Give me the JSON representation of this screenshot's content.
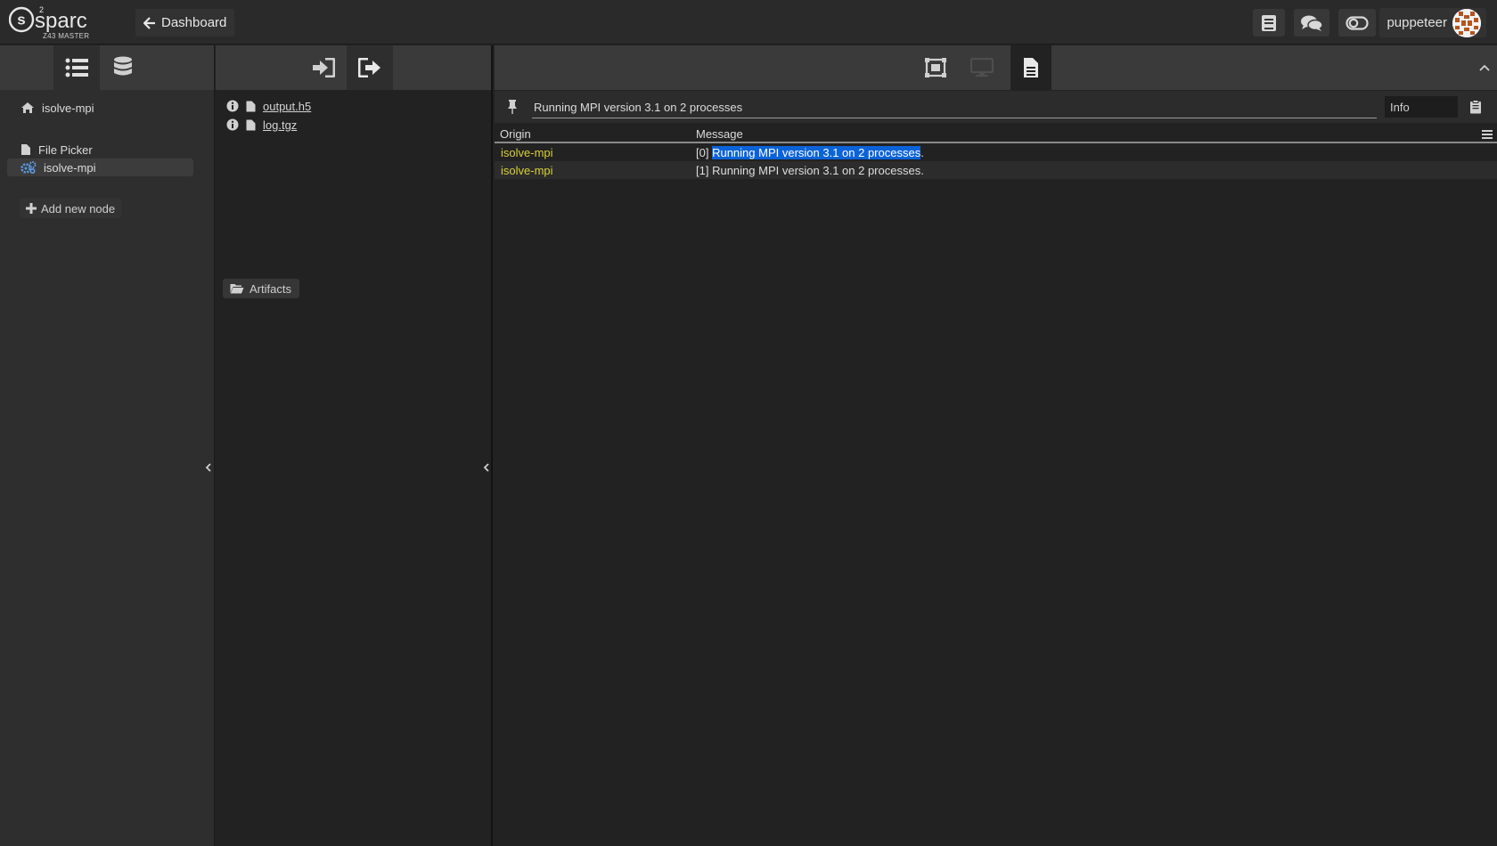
{
  "app": {
    "logo_text": "sparc",
    "logo_superscript": "2",
    "logo_subtitle": "Z43 MASTER"
  },
  "topbar": {
    "dashboard_label": "Dashboard",
    "user_name": "puppeteer"
  },
  "sidebar": {
    "study_root": "isolve-mpi",
    "nodes": [
      {
        "label": "File Picker",
        "icon": "file-icon",
        "selected": false
      },
      {
        "label": "isolve-mpi",
        "icon": "cogs-icon",
        "selected": true
      }
    ],
    "add_node_label": "Add new node"
  },
  "ports": {
    "files": [
      {
        "name": "output.h5"
      },
      {
        "name": "log.tgz"
      }
    ],
    "artifacts_label": "Artifacts"
  },
  "logger": {
    "filter_value": "Running MPI version 3.1 on 2 processes",
    "level_value": "Info",
    "columns": {
      "origin": "Origin",
      "message": "Message"
    },
    "rows": [
      {
        "origin": "isolve-mpi",
        "prefix": "[0] ",
        "selected_text": "Running MPI version 3.1 on 2 processes",
        "suffix": "."
      },
      {
        "origin": "isolve-mpi",
        "prefix": "[1] ",
        "selected_text": "",
        "suffix": "Running MPI version 3.1 on 2 processes."
      }
    ]
  },
  "colors": {
    "origin_text": "#d9cf3a",
    "selection": "#0b63d8",
    "background": "#222222"
  }
}
